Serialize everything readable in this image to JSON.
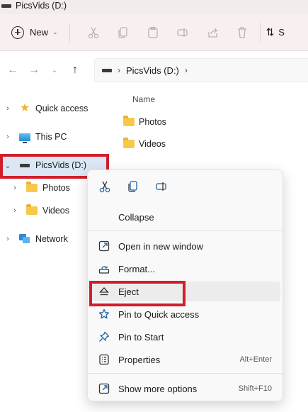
{
  "window": {
    "title": "PicsVids (D:)"
  },
  "toolbar": {
    "new_label": "New",
    "sort_label": "S",
    "icons": [
      "cut-icon",
      "copy-icon",
      "paste-icon",
      "rename-icon",
      "share-icon",
      "delete-icon"
    ]
  },
  "address": {
    "crumbs": [
      "PicsVids (D:)"
    ]
  },
  "nav": {
    "items": [
      {
        "label": "Quick access",
        "icon": "star-icon"
      },
      {
        "label": "This PC",
        "icon": "computer-icon"
      },
      {
        "label": "PicsVids (D:)",
        "icon": "drive-icon",
        "selected": true
      },
      {
        "label": "Photos",
        "icon": "folder-icon"
      },
      {
        "label": "Videos",
        "icon": "folder-icon"
      },
      {
        "label": "Network",
        "icon": "network-icon"
      }
    ]
  },
  "content": {
    "column_header": "Name",
    "files": [
      {
        "name": "Photos",
        "type": "folder"
      },
      {
        "name": "Videos",
        "type": "folder"
      }
    ]
  },
  "context_menu": {
    "quick_icons": [
      "cut-icon",
      "copy-icon",
      "rename-icon"
    ],
    "collapse": "Collapse",
    "items": [
      {
        "label": "Open in new window",
        "icon": "open-new-window-icon",
        "shortcut": ""
      },
      {
        "label": "Format...",
        "icon": "format-icon",
        "shortcut": ""
      },
      {
        "label": "Eject",
        "icon": "eject-icon",
        "shortcut": "",
        "highlighted": true
      },
      {
        "label": "Pin to Quick access",
        "icon": "star-outline-icon",
        "shortcut": ""
      },
      {
        "label": "Pin to Start",
        "icon": "pin-icon",
        "shortcut": ""
      },
      {
        "label": "Properties",
        "icon": "properties-icon",
        "shortcut": "Alt+Enter"
      }
    ],
    "more": {
      "label": "Show more options",
      "icon": "show-more-icon",
      "shortcut": "Shift+F10"
    }
  },
  "colors": {
    "accent": "#1e5fa8",
    "highlight_box": "#d11e2a",
    "selected_bg": "#dbe7f4",
    "folder": "#f7c94a"
  }
}
